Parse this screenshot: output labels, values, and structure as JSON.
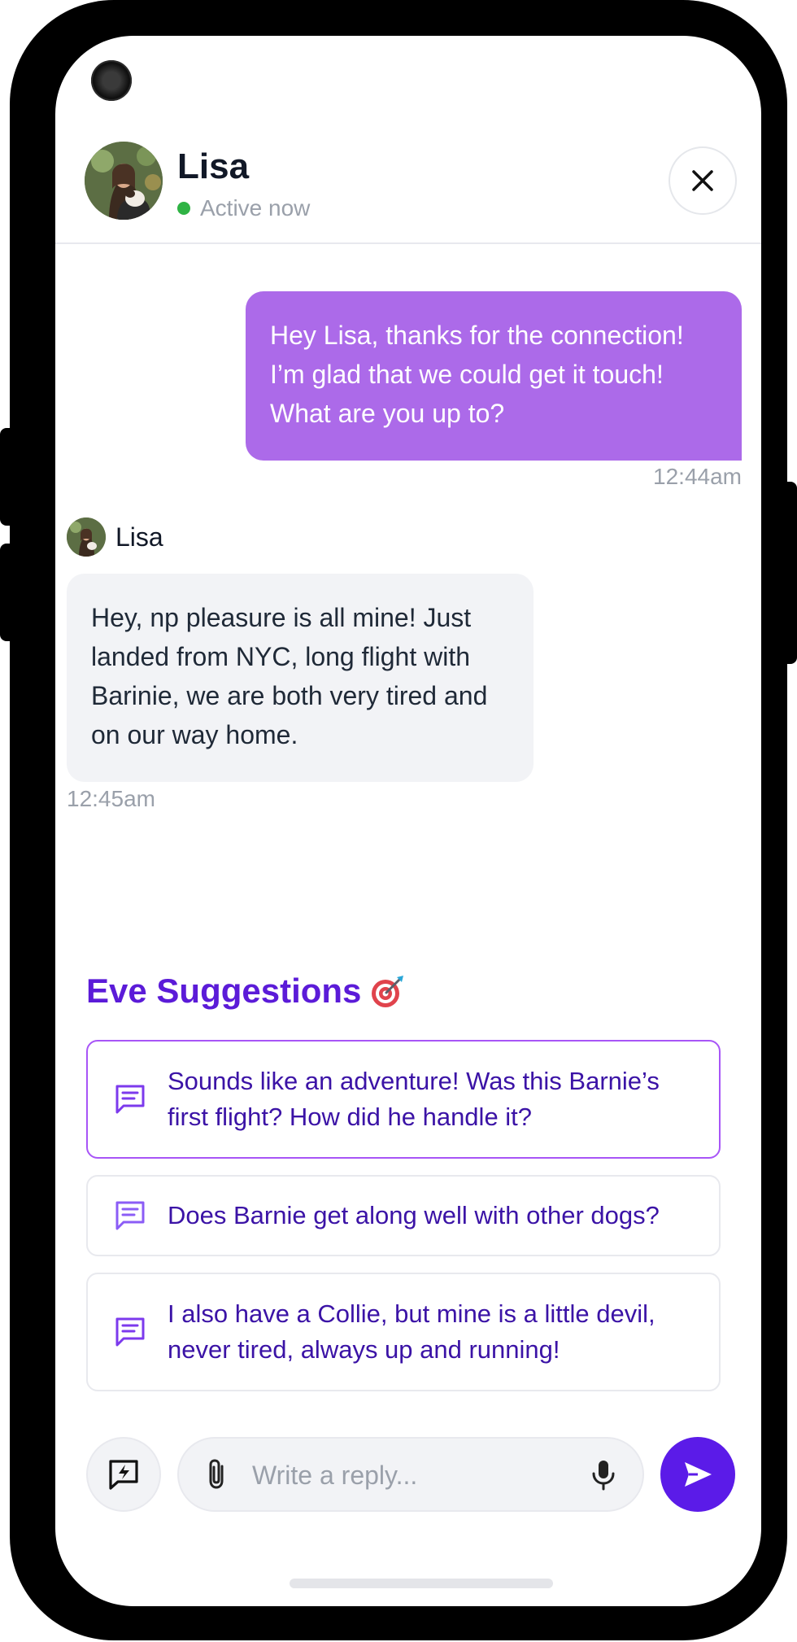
{
  "contact": {
    "name": "Lisa",
    "status": "Active now"
  },
  "messages": [
    {
      "direction": "outgoing",
      "text": "Hey Lisa, thanks for the connection! I’m glad that we could get it touch! What are you up to?",
      "time": "12:44am"
    },
    {
      "direction": "incoming",
      "sender": "Lisa",
      "text": "Hey, np pleasure is all mine! Just landed from NYC, long flight with Barinie, we are both very tired and on our way home.",
      "time": "12:45am"
    }
  ],
  "suggestions": {
    "title": "Eve Suggestions",
    "title_icon": "dart-target-icon",
    "items": [
      {
        "text": "Sounds like an adventure! Was this Barnie’s first flight? How did he handle it?",
        "icon": "message-icon",
        "selected": true
      },
      {
        "text": "Does Barnie get along well with other dogs?",
        "icon": "message-icon",
        "selected": false
      },
      {
        "text": "I also have a Collie, but mine is a little devil, never tired, always up and running!",
        "icon": "message-icon",
        "selected": false
      }
    ]
  },
  "composer": {
    "placeholder": "Write a reply...",
    "value": ""
  },
  "icons": {
    "close": "close-icon",
    "quick_reply": "lightning-chat-icon",
    "attach": "paperclip-icon",
    "mic": "microphone-icon",
    "send": "send-icon"
  },
  "colors": {
    "outgoing_bubble": "#ac6ae9",
    "incoming_bubble": "#f2f3f6",
    "accent": "#5b1be8",
    "suggestion_text": "#3b13a6",
    "active_dot": "#2fb344",
    "selected_border": "#a855f7"
  }
}
